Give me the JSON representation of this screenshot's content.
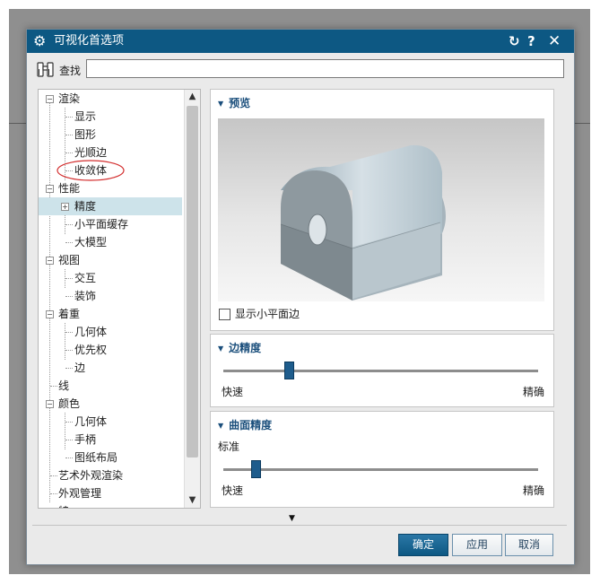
{
  "dialog": {
    "title": "可视化首选项",
    "find_label": "查找",
    "find_value": ""
  },
  "tree": {
    "items": [
      {
        "label": "渲染"
      },
      {
        "label": "显示"
      },
      {
        "label": "图形"
      },
      {
        "label": "光顺边"
      },
      {
        "label": "收敛体"
      },
      {
        "label": "性能"
      },
      {
        "label": "精度"
      },
      {
        "label": "小平面缓存"
      },
      {
        "label": "大模型"
      },
      {
        "label": "视图"
      },
      {
        "label": "交互"
      },
      {
        "label": "装饰"
      },
      {
        "label": "着重"
      },
      {
        "label": "几何体"
      },
      {
        "label": "优先权"
      },
      {
        "label": "边"
      },
      {
        "label": "线"
      },
      {
        "label": "颜色"
      },
      {
        "label": "几何体"
      },
      {
        "label": "手柄"
      },
      {
        "label": "图纸布局"
      },
      {
        "label": "艺术外观渲染"
      },
      {
        "label": "外观管理"
      },
      {
        "label": "特"
      }
    ],
    "selected": "精度",
    "highlighted": "收敛体"
  },
  "preview": {
    "header": "预览",
    "show_facet_edges_label": "显示小平面边",
    "show_facet_edges_checked": false
  },
  "edge_precision": {
    "header": "边精度",
    "min_label": "快速",
    "max_label": "精确",
    "value_fraction": 0.2
  },
  "surface_precision": {
    "header": "曲面精度",
    "level_label": "标准",
    "min_label": "快速",
    "max_label": "精确",
    "value_fraction": 0.09
  },
  "buttons": {
    "ok": "确定",
    "apply": "应用",
    "cancel": "取消"
  },
  "colors": {
    "title_bar": "#0d5883",
    "section_header": "#1b4f7c",
    "slider_thumb": "#1e5c8c",
    "selection": "#cde3ea",
    "highlight_circle": "#d32f2f"
  },
  "icons": {
    "title": "gear-icon",
    "reset": "reset-icon",
    "help": "help-icon",
    "close": "close-icon",
    "find": "binoculars-icon"
  }
}
